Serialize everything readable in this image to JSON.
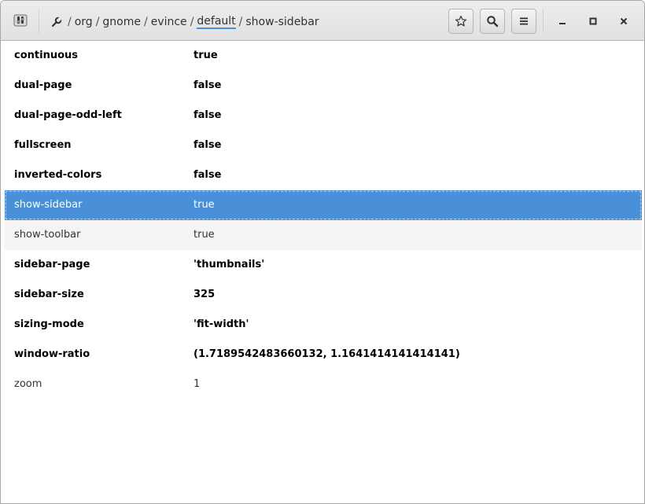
{
  "header": {
    "path": {
      "separator": "/",
      "segments": [
        {
          "label": "org"
        },
        {
          "label": "gnome"
        },
        {
          "label": "evince"
        },
        {
          "label": "default"
        },
        {
          "label": "show-sidebar"
        }
      ],
      "active_index": 3
    },
    "buttons": [
      "bookmark-star-icon",
      "search-icon",
      "menu-icon"
    ],
    "window_controls": [
      "minimize-icon",
      "maximize-icon",
      "close-icon"
    ]
  },
  "keys": [
    {
      "name": "continuous",
      "value": "true"
    },
    {
      "name": "dual-page",
      "value": "false"
    },
    {
      "name": "dual-page-odd-left",
      "value": "false"
    },
    {
      "name": "fullscreen",
      "value": "false"
    },
    {
      "name": "inverted-colors",
      "value": "false"
    },
    {
      "name": "show-sidebar",
      "value": "true"
    },
    {
      "name": "show-toolbar",
      "value": "true"
    },
    {
      "name": "sidebar-page",
      "value": "'thumbnails'"
    },
    {
      "name": "sidebar-size",
      "value": "325"
    },
    {
      "name": "sizing-mode",
      "value": "'fit-width'"
    },
    {
      "name": "window-ratio",
      "value": "(1.7189542483660132, 1.1641414141414141)"
    },
    {
      "name": "zoom",
      "value": "1"
    }
  ],
  "row_styles": [
    "bold",
    "bold",
    "bold",
    "bold",
    "bold",
    "selected",
    "alt",
    "bold",
    "bold",
    "bold",
    "bold",
    "normal"
  ],
  "colors": {
    "accent": "#4a90d9",
    "header_bg": "#e8e8e7",
    "row_alt": "#f4f4f4"
  }
}
